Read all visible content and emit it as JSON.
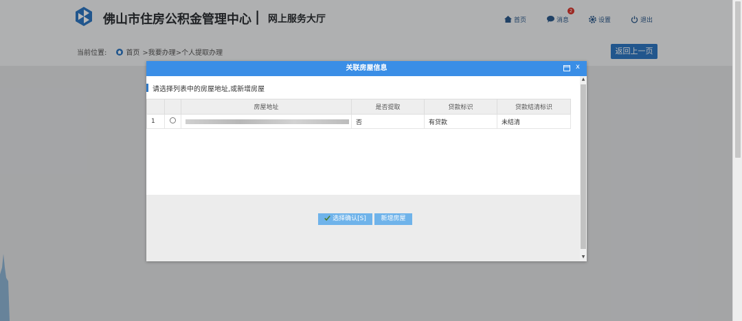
{
  "header": {
    "site_title": "佛山市住房公积金管理中心",
    "separator": "|",
    "site_subtitle": "网上服务大厅",
    "nav": {
      "home": "首页",
      "messages": "消息",
      "message_badge": "2",
      "settings": "设置",
      "logout": "退出"
    }
  },
  "breadcrumb": {
    "label": "当前位置:",
    "home": "首页",
    "path": ">我要办理>个人提取办理"
  },
  "back_button": "返回上一页",
  "dialog": {
    "title": "关联房屋信息",
    "close_glyph": "x",
    "instruction": "请选择列表中的房屋地址,或新增房屋",
    "columns": [
      "",
      "",
      "房屋地址",
      "是否提取",
      "贷款标识",
      "贷款结清标识"
    ],
    "rows": [
      {
        "index": "1",
        "address": "",
        "extracted": "否",
        "loan_flag": "有贷款",
        "settled_flag": "未结清"
      }
    ],
    "confirm_button": "选择确认[S]",
    "add_button": "新增房屋"
  },
  "colors": {
    "brand_blue": "#2f78c4",
    "dialog_title_bar": "#3a8ee6",
    "button_light_blue": "#6fb3ea",
    "badge_red": "#d9342b"
  }
}
